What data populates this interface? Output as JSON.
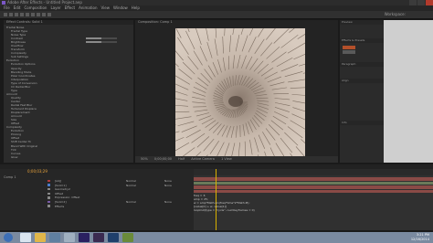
{
  "window": {
    "title": "Adobe After Effects - Untitled Project.aep"
  },
  "menubar": [
    "File",
    "Edit",
    "Composition",
    "Layer",
    "Effect",
    "Animation",
    "View",
    "Window",
    "Help"
  ],
  "toolbar": {
    "workspace_label": "Workspace:"
  },
  "effects_panel": {
    "tab": "Effect Controls: Solid 1",
    "rows": [
      {
        "label": "Fractal Noise",
        "value": ""
      },
      {
        "label": "Fractal Type",
        "value": ""
      },
      {
        "label": "Noise Type",
        "value": ""
      },
      {
        "label": "Contrast",
        "value": "",
        "bar": 0.5
      },
      {
        "label": "Brightness",
        "value": "",
        "bar": 0.5
      },
      {
        "label": "Overflow",
        "value": ""
      },
      {
        "label": "Transform",
        "value": ""
      },
      {
        "label": "Complexity",
        "value": ""
      },
      {
        "label": "Sub Settings",
        "value": ""
      },
      {
        "label": "Evolution",
        "value": ""
      },
      {
        "label": "Evolution Options",
        "value": ""
      },
      {
        "label": "Opacity",
        "value": ""
      },
      {
        "label": "Blending Mode",
        "value": ""
      },
      {
        "label": "Polar Coordinates",
        "value": ""
      },
      {
        "label": "Interpolation",
        "value": ""
      },
      {
        "label": "Type of Conversion",
        "value": ""
      },
      {
        "label": "CC Radial Blur",
        "value": ""
      },
      {
        "label": "Type",
        "value": ""
      },
      {
        "label": "Amount",
        "value": ""
      },
      {
        "label": "Quality",
        "value": ""
      },
      {
        "label": "Center",
        "value": ""
      },
      {
        "label": "Radial Fast Blur",
        "value": ""
      },
      {
        "label": "Turbulent Displace",
        "value": ""
      },
      {
        "label": "Displacement",
        "value": ""
      },
      {
        "label": "Amount",
        "value": ""
      },
      {
        "label": "Size",
        "value": ""
      },
      {
        "label": "Offset",
        "value": ""
      },
      {
        "label": "Complexity",
        "value": ""
      },
      {
        "label": "Evolution",
        "value": ""
      },
      {
        "label": "Pinning",
        "value": ""
      },
      {
        "label": "Offset",
        "value": ""
      },
      {
        "label": "Shift Center To",
        "value": ""
      },
      {
        "label": "Blend With Original",
        "value": ""
      },
      {
        "label": "Tint",
        "value": ""
      },
      {
        "label": "Curves",
        "value": ""
      },
      {
        "label": "Glow",
        "value": ""
      }
    ]
  },
  "comp_panel": {
    "tab": "Composition: Comp 1",
    "footer": [
      "50%",
      "0;00;00;00",
      "Half",
      "Active Camera",
      "1 View"
    ]
  },
  "side_panel": {
    "preview": "Preview",
    "effects": "Effects & Presets",
    "info": "Info",
    "paragraph": "Paragraph",
    "character": "Character",
    "align": "Align"
  },
  "timeline": {
    "tab": "Comp 1",
    "timecode": "0;00;03;29",
    "layers": [
      {
        "name": "[Adj]",
        "mode": "Normal",
        "parent": "None",
        "color": "#b13c3c"
      },
      {
        "name": "[Solid 1]",
        "mode": "Normal",
        "parent": "None",
        "color": "#4a7ac9"
      },
      {
        "name": "Geometry2",
        "mode": "",
        "parent": "",
        "color": "#888888"
      },
      {
        "name": "Offset",
        "mode": "",
        "parent": "",
        "color": "#888888"
      },
      {
        "name": "Expression: Offset",
        "mode": "",
        "parent": "",
        "color": "#888888"
      },
      {
        "name": "[Solid 2]",
        "mode": "Normal",
        "parent": "None",
        "color": "#7a5ba8"
      },
      {
        "name": "Effects",
        "mode": "",
        "parent": "",
        "color": "#888888"
      }
    ],
    "expression_lines": [
      "freq = 3;",
      "amp = 25;",
      "w = amp*Math.sin(freq*time*2*Math.PI);",
      "[value[0] + w, value[1]]",
      "",
      "loopOut(type = \"cycle\", numKeyframes = 0)"
    ]
  },
  "taskbar": {
    "time": "3:21 PM",
    "date": "12/16/2014"
  },
  "colors": {
    "timecode": "#e8a23a",
    "playhead": "#d8b000",
    "accent": "#7b57c6"
  }
}
